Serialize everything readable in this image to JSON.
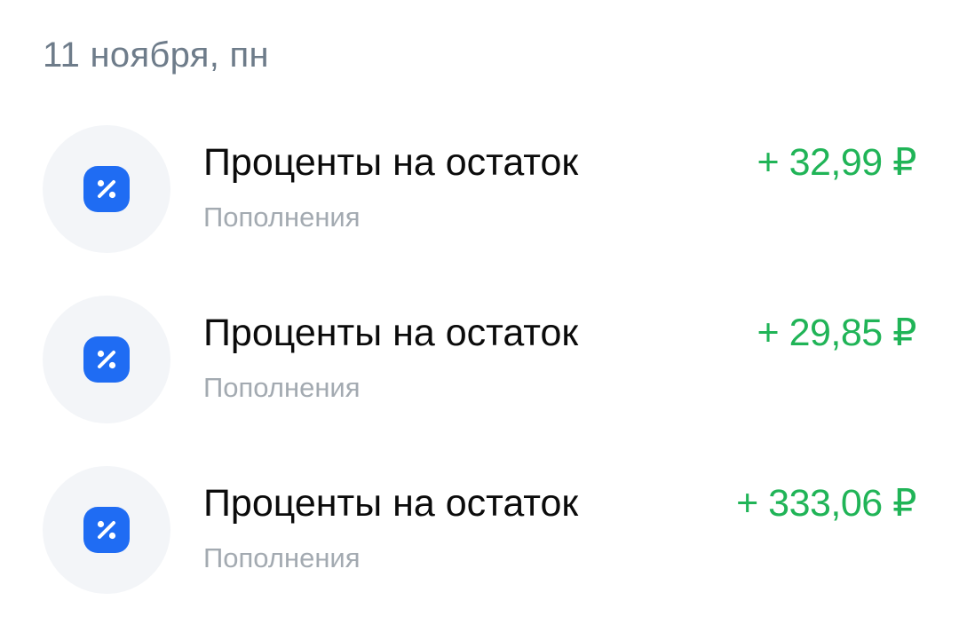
{
  "date_header": "11 ноября, пн",
  "colors": {
    "amount_positive": "#20b457",
    "icon_background": "#1f6cf3",
    "avatar_background": "#f3f5f8"
  },
  "transactions": [
    {
      "title": "Проценты на остаток",
      "category": "Пополнения",
      "amount": "+ 32,99 ₽",
      "icon": "percent-icon"
    },
    {
      "title": "Проценты на остаток",
      "category": "Пополнения",
      "amount": "+ 29,85 ₽",
      "icon": "percent-icon"
    },
    {
      "title": "Проценты на остаток",
      "category": "Пополнения",
      "amount": "+ 333,06 ₽",
      "icon": "percent-icon"
    }
  ]
}
